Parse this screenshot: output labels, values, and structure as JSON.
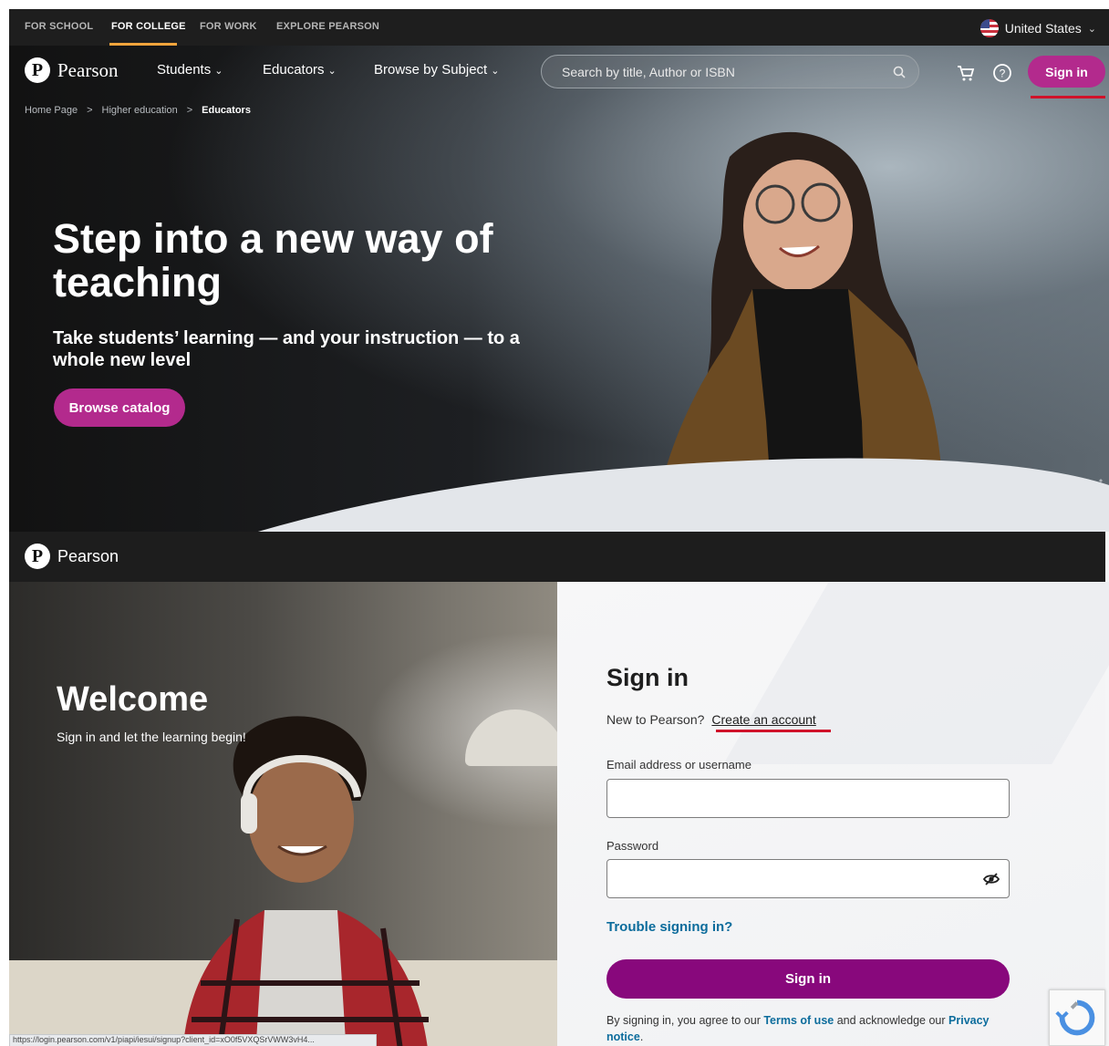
{
  "top": {
    "utility_links": [
      "FOR SCHOOL",
      "FOR COLLEGE",
      "FOR WORK",
      "EXPLORE PEARSON"
    ],
    "active_utility": "FOR COLLEGE",
    "region_label": "United States",
    "brand": "Pearson",
    "nav": {
      "students": "Students",
      "educators": "Educators",
      "browse_subject": "Browse by Subject"
    },
    "search_placeholder": "Search by title, Author or ISBN",
    "sign_in": "Sign in",
    "breadcrumb": [
      "Home Page",
      ">",
      "Higher education",
      ">",
      "Educators"
    ],
    "hero_title": "Step into a new way of teaching",
    "hero_subtitle": "Take students’ learning — and your instruction — to a whole new level",
    "browse_button": "Browse catalog",
    "accent_color": "#b32a8d",
    "active_underline_color": "#f2a43c",
    "annotation_color": "#d0122a"
  },
  "login": {
    "brand": "Pearson",
    "welcome_title": "Welcome",
    "welcome_subtitle": "Sign in and let the learning begin!",
    "heading": "Sign in",
    "new_prompt": "New to Pearson?",
    "create_account": "Create an account",
    "email_label": "Email address or username",
    "email_value": "",
    "password_label": "Password",
    "password_value": "",
    "trouble": "Trouble signing in?",
    "sign_in_button": "Sign in",
    "legal_prefix": "By signing in, you agree to our",
    "terms": "Terms of use",
    "legal_middle": "and acknowledge our",
    "privacy": "Privacy notice",
    "legal_suffix": ".",
    "status_url": "https://login.pearson.com/v1/piapi/iesui/signup?client_id=xO0f5VXQSrVWW3vH4...",
    "button_color": "#88087c",
    "link_color": "#0c6c9c"
  }
}
